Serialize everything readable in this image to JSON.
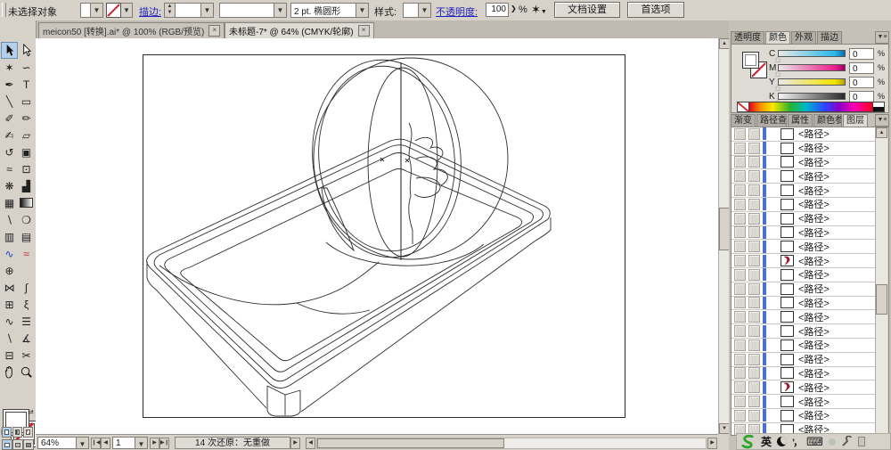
{
  "control_bar": {
    "no_selection_label": "未选择对象",
    "fill_swatch": "",
    "stroke_color": "none",
    "stroke_label": "描边:",
    "stroke_weight": "",
    "brush": "",
    "brush_definition": "2 pt. 椭圆形",
    "style_label": "样式:",
    "style_value": "",
    "opacity_label": "不透明度:",
    "opacity_value": "100",
    "percent": "%",
    "doc_setup_button": "文档设置",
    "preferences_button": "首选项"
  },
  "doc_tabs": [
    {
      "label": "meicon50 [转换].ai* @ 100% (RGB/预览)",
      "active": false
    },
    {
      "label": "未标题-7* @ 64% (CMYK/轮廓)",
      "active": true
    }
  ],
  "tools": [
    {
      "name": "selection-tool",
      "type": "arrow-filled",
      "selected": true
    },
    {
      "name": "direct-selection-tool",
      "type": "arrow-outline"
    },
    {
      "name": "magic-wand-tool",
      "glyph": "✶"
    },
    {
      "name": "lasso-tool",
      "glyph": "∽"
    },
    {
      "name": "pen-tool",
      "glyph": "✒"
    },
    {
      "name": "type-tool",
      "glyph": "T"
    },
    {
      "name": "line-segment-tool",
      "glyph": "╲"
    },
    {
      "name": "rectangle-tool",
      "glyph": "▭"
    },
    {
      "name": "paintbrush-tool",
      "glyph": "✐"
    },
    {
      "name": "pencil-tool",
      "glyph": "✏"
    },
    {
      "name": "smooth-tool",
      "glyph": "✍"
    },
    {
      "name": "eraser-tool",
      "glyph": "▱"
    },
    {
      "name": "rotate-tool",
      "glyph": "↺"
    },
    {
      "name": "scale-tool",
      "glyph": "▣"
    },
    {
      "name": "warp-tool",
      "glyph": "≈"
    },
    {
      "name": "free-transform-tool",
      "glyph": "⊡"
    },
    {
      "name": "symbol-sprayer-tool",
      "glyph": "❋"
    },
    {
      "name": "graph-tool",
      "glyph": "▟"
    },
    {
      "name": "mesh-tool",
      "glyph": "▦"
    },
    {
      "name": "gradient-tool",
      "type": "gradient"
    },
    {
      "name": "eyedropper-tool",
      "glyph": "∖"
    },
    {
      "name": "blend-tool",
      "glyph": "❍"
    },
    {
      "name": "live-paint-bucket-tool",
      "glyph": "▥"
    },
    {
      "name": "live-paint-selection-tool",
      "glyph": "▤"
    },
    {
      "name": "curve-blue-tool",
      "glyph": "∿",
      "color": "#2244cc"
    },
    {
      "name": "curves-multicolor-tool",
      "glyph": "≈",
      "color": "#cc2222"
    },
    {
      "name": "page-tool",
      "glyph": "⊕"
    },
    {
      "name": "empty-slot",
      "glyph": ""
    },
    {
      "name": "envelope-distort-tool",
      "glyph": "⋈"
    },
    {
      "name": "shape-curve-tool",
      "glyph": "∫"
    },
    {
      "name": "mesh-grid-tool",
      "glyph": "⊞"
    },
    {
      "name": "wrinkle-tool",
      "glyph": "ξ"
    },
    {
      "name": "zigzag-tool",
      "glyph": "∿"
    },
    {
      "name": "stroke-options-tool",
      "glyph": "☰"
    },
    {
      "name": "eyedropper-2-tool",
      "glyph": "∖"
    },
    {
      "name": "measure-tool",
      "glyph": "∡"
    },
    {
      "name": "crop-tool",
      "glyph": "⊟"
    },
    {
      "name": "knife-tool",
      "glyph": "✂"
    },
    {
      "name": "hand-tool",
      "type": "hand"
    },
    {
      "name": "zoom-tool",
      "type": "zoom"
    }
  ],
  "panels": {
    "group1_tabs": [
      {
        "label": "透明度",
        "active": false
      },
      {
        "label": "颜色",
        "active": true
      },
      {
        "label": "外观",
        "active": false
      },
      {
        "label": "描边",
        "active": false
      }
    ],
    "color": {
      "channels": [
        {
          "label": "C",
          "value": "0"
        },
        {
          "label": "M",
          "value": "0"
        },
        {
          "label": "Y",
          "value": "0"
        },
        {
          "label": "K",
          "value": "0"
        }
      ],
      "unit": "%"
    },
    "group2_tabs": [
      {
        "label": "渐变",
        "active": false
      },
      {
        "label": "路径查找器",
        "active": false
      },
      {
        "label": "属性",
        "active": false
      },
      {
        "label": "颜色参考",
        "active": false
      },
      {
        "label": "图层",
        "active": true
      }
    ],
    "layers": {
      "path_label": "<路径>",
      "rows": [
        {
          "thumb": "blank",
          "target": "filled"
        },
        {
          "thumb": "blank",
          "target": "filled"
        },
        {
          "thumb": "blank",
          "target": "filled"
        },
        {
          "thumb": "blank",
          "target": "filled"
        },
        {
          "thumb": "blank",
          "target": "filled"
        },
        {
          "thumb": "blank",
          "target": "filled"
        },
        {
          "thumb": "blank",
          "target": "filled"
        },
        {
          "thumb": "blank",
          "target": "filled"
        },
        {
          "thumb": "blank",
          "target": "filled"
        },
        {
          "thumb": "flame",
          "target": "hollow"
        },
        {
          "thumb": "blank",
          "target": "hollow"
        },
        {
          "thumb": "blank",
          "target": "hollow"
        },
        {
          "thumb": "blank",
          "target": "hollow"
        },
        {
          "thumb": "blank",
          "target": "hollow"
        },
        {
          "thumb": "blank",
          "target": "hollow"
        },
        {
          "thumb": "blank",
          "target": "hollow"
        },
        {
          "thumb": "blank",
          "target": "filled"
        },
        {
          "thumb": "blank",
          "target": "filled"
        },
        {
          "thumb": "flame",
          "target": "hollow"
        },
        {
          "thumb": "blank",
          "target": "hollow"
        },
        {
          "thumb": "blank",
          "target": "hollow"
        },
        {
          "thumb": "blank",
          "target": "hollow"
        }
      ]
    }
  },
  "status_bar": {
    "zoom_value": "64%",
    "page_value": "1",
    "undo_status": "14 次还原：无重做"
  },
  "ime": {
    "lang_indicator": "英",
    "punctuation": "’，"
  },
  "colors": {
    "ui_base": "#d6d2ca",
    "active_tab": "#dedbd4",
    "link_blue": "#2222bb",
    "layer_selection_bar": "#4a6fd6",
    "tool_selected_bg": "#b3cfe9",
    "ime_logo_green": "#2ea52c",
    "flame_red": "#b01030"
  }
}
